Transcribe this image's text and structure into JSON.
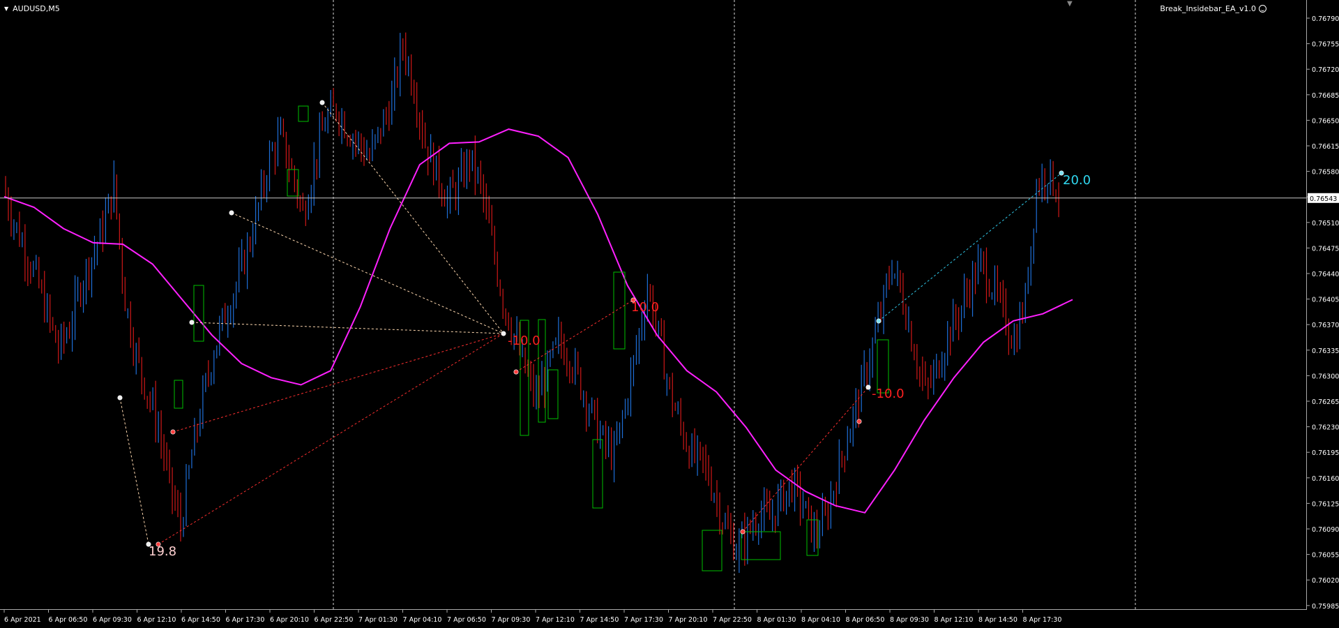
{
  "window": {
    "symbol_label": "AUDUSD,M5",
    "ea_name": "Break_Insidebar_EA_v1.0",
    "menu_icon": "triangle-down-icon",
    "ea_icon": "smiley-icon"
  },
  "colors": {
    "background": "#000000",
    "bull_candle": "#1e6fd9",
    "bear_candle": "#d01818",
    "moving_average": "#ff20ff",
    "box": "#00c000",
    "crosshair": "#c8c8c8",
    "separator": "#d8d8d8",
    "profit_line": "#ffd9b0",
    "loss_line": "#ff3030",
    "tp_line": "#30c8e8"
  },
  "current_price": "0.76543",
  "price_axis": [
    "0.76790",
    "0.76755",
    "0.76720",
    "0.76685",
    "0.76650",
    "0.76615",
    "0.76580",
    "0.76545",
    "0.76510",
    "0.76475",
    "0.76440",
    "0.76405",
    "0.76370",
    "0.76335",
    "0.76300",
    "0.76265",
    "0.76230",
    "0.76195",
    "0.76160",
    "0.76125",
    "0.76090",
    "0.76055",
    "0.76020",
    "0.75985"
  ],
  "time_axis": [
    "6 Apr 2021",
    "6 Apr 06:50",
    "6 Apr 09:30",
    "6 Apr 12:10",
    "6 Apr 14:50",
    "6 Apr 17:30",
    "6 Apr 20:10",
    "6 Apr 22:50",
    "7 Apr 01:30",
    "7 Apr 04:10",
    "7 Apr 06:50",
    "7 Apr 09:30",
    "7 Apr 12:10",
    "7 Apr 14:50",
    "7 Apr 17:30",
    "7 Apr 20:10",
    "7 Apr 22:50",
    "8 Apr 01:30",
    "8 Apr 04:10",
    "8 Apr 06:50",
    "8 Apr 09:30",
    "8 Apr 12:10",
    "8 Apr 14:50",
    "8 Apr 17:30"
  ],
  "trade_labels": [
    {
      "text": "19.8",
      "color": "#ffd0d0",
      "price": 0.76062,
      "time": "6 Apr 12:10"
    },
    {
      "text": "10.0",
      "color": "#ff2020",
      "price": 0.76401,
      "time": "7 Apr 17:30"
    },
    {
      "text": "20.0",
      "color": "#30d8f0",
      "price": 0.76568,
      "time": "8 Apr 17:30"
    },
    {
      "text": "-10.0",
      "color": "#ff2020",
      "price": 0.76282,
      "time": "8 Apr 06:50"
    },
    {
      "text": "-10.0",
      "color": "#ff2020",
      "price": 0.76352,
      "time": "7 Apr 09:30"
    }
  ],
  "chart_data": {
    "type": "candlestick",
    "symbol": "AUDUSD",
    "timeframe": "M5",
    "ylim": [
      0.75975,
      0.7681
    ],
    "close_series": [
      0.7656,
      0.7651,
      0.7647,
      0.7643,
      0.7638,
      0.7633,
      0.7636,
      0.7642,
      0.7646,
      0.765,
      0.7656,
      0.764,
      0.7632,
      0.7627,
      0.7622,
      0.7614,
      0.7608,
      0.7618,
      0.7626,
      0.7633,
      0.7638,
      0.7642,
      0.7647,
      0.7653,
      0.766,
      0.7663,
      0.7658,
      0.7652,
      0.7659,
      0.7665,
      0.7667,
      0.7664,
      0.7662,
      0.766,
      0.7664,
      0.7668,
      0.7676,
      0.767,
      0.7662,
      0.7658,
      0.7654,
      0.7656,
      0.766,
      0.7656,
      0.7648,
      0.764,
      0.7635,
      0.763,
      0.7626,
      0.763,
      0.7634,
      0.7632,
      0.7628,
      0.7624,
      0.762,
      0.7618,
      0.7625,
      0.7633,
      0.7642,
      0.7635,
      0.7627,
      0.7622,
      0.7618,
      0.7617,
      0.7613,
      0.7608,
      0.7605,
      0.7607,
      0.761,
      0.7609,
      0.7612,
      0.7614,
      0.7611,
      0.7607,
      0.7609,
      0.7615,
      0.7621,
      0.7626,
      0.7632,
      0.7638,
      0.7645,
      0.764,
      0.7633,
      0.7627,
      0.763,
      0.7635,
      0.7638,
      0.7642,
      0.7645,
      0.7642,
      0.7638,
      0.7634,
      0.764,
      0.7656,
      0.7658,
      0.7655
    ],
    "moving_average": [
      0.76545,
      0.7653,
      0.765,
      0.7648,
      0.76478,
      0.7645,
      0.764,
      0.7635,
      0.7631,
      0.7629,
      0.7628,
      0.763,
      0.7639,
      0.765,
      0.7659,
      0.7662,
      0.76622,
      0.7664,
      0.7663,
      0.766,
      0.7652,
      0.7642,
      0.7635,
      0.763,
      0.7627,
      0.7622,
      0.7616,
      0.7613,
      0.7611,
      0.761,
      0.7616,
      0.7623,
      0.7629,
      0.7634,
      0.7637,
      0.7638,
      0.764
    ],
    "horizontal_line": 0.76543,
    "vertical_separators": [
      "6 Apr 22:50",
      "7 Apr 22:50",
      "8 Apr 22:50"
    ]
  }
}
